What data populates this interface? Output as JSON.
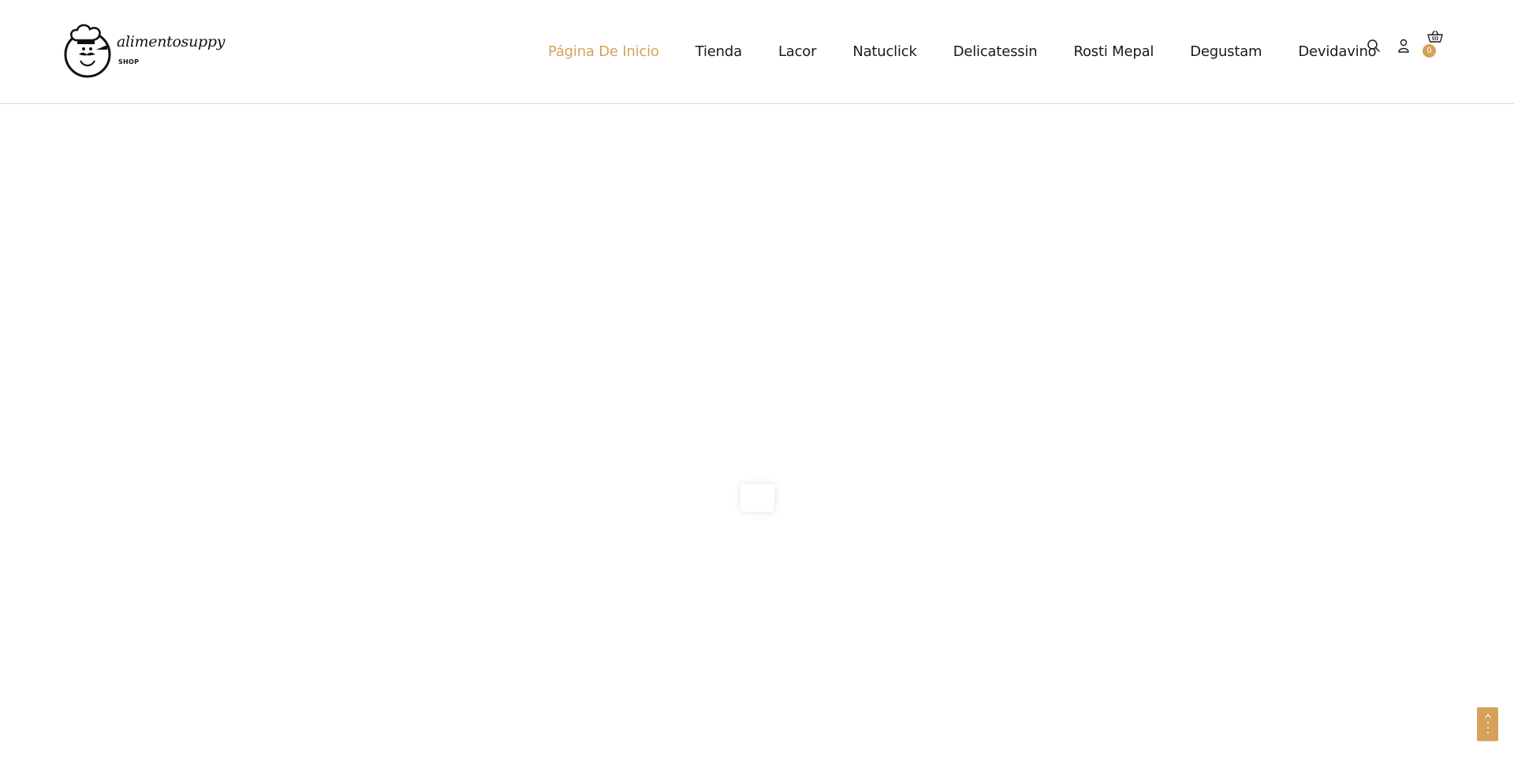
{
  "brand": {
    "name": "alimentosuppy",
    "sub": "SHOP"
  },
  "nav": {
    "items": [
      {
        "label": "Página De Inicio",
        "active": true
      },
      {
        "label": "Tienda"
      },
      {
        "label": "Lacor"
      },
      {
        "label": "Natuclick"
      },
      {
        "label": "Delicatessin"
      },
      {
        "label": "Rosti Mepal"
      },
      {
        "label": "Degustam"
      },
      {
        "label": "Devidavino"
      }
    ]
  },
  "header_icons": {
    "search": "search-icon",
    "account": "user-icon",
    "cart": "basket-icon",
    "cart_count": "0"
  },
  "colors": {
    "accent": "#d5a15b",
    "text": "#1a1a1a",
    "border": "#d9d9d9"
  },
  "back_to_top": "arrow-up-icon"
}
